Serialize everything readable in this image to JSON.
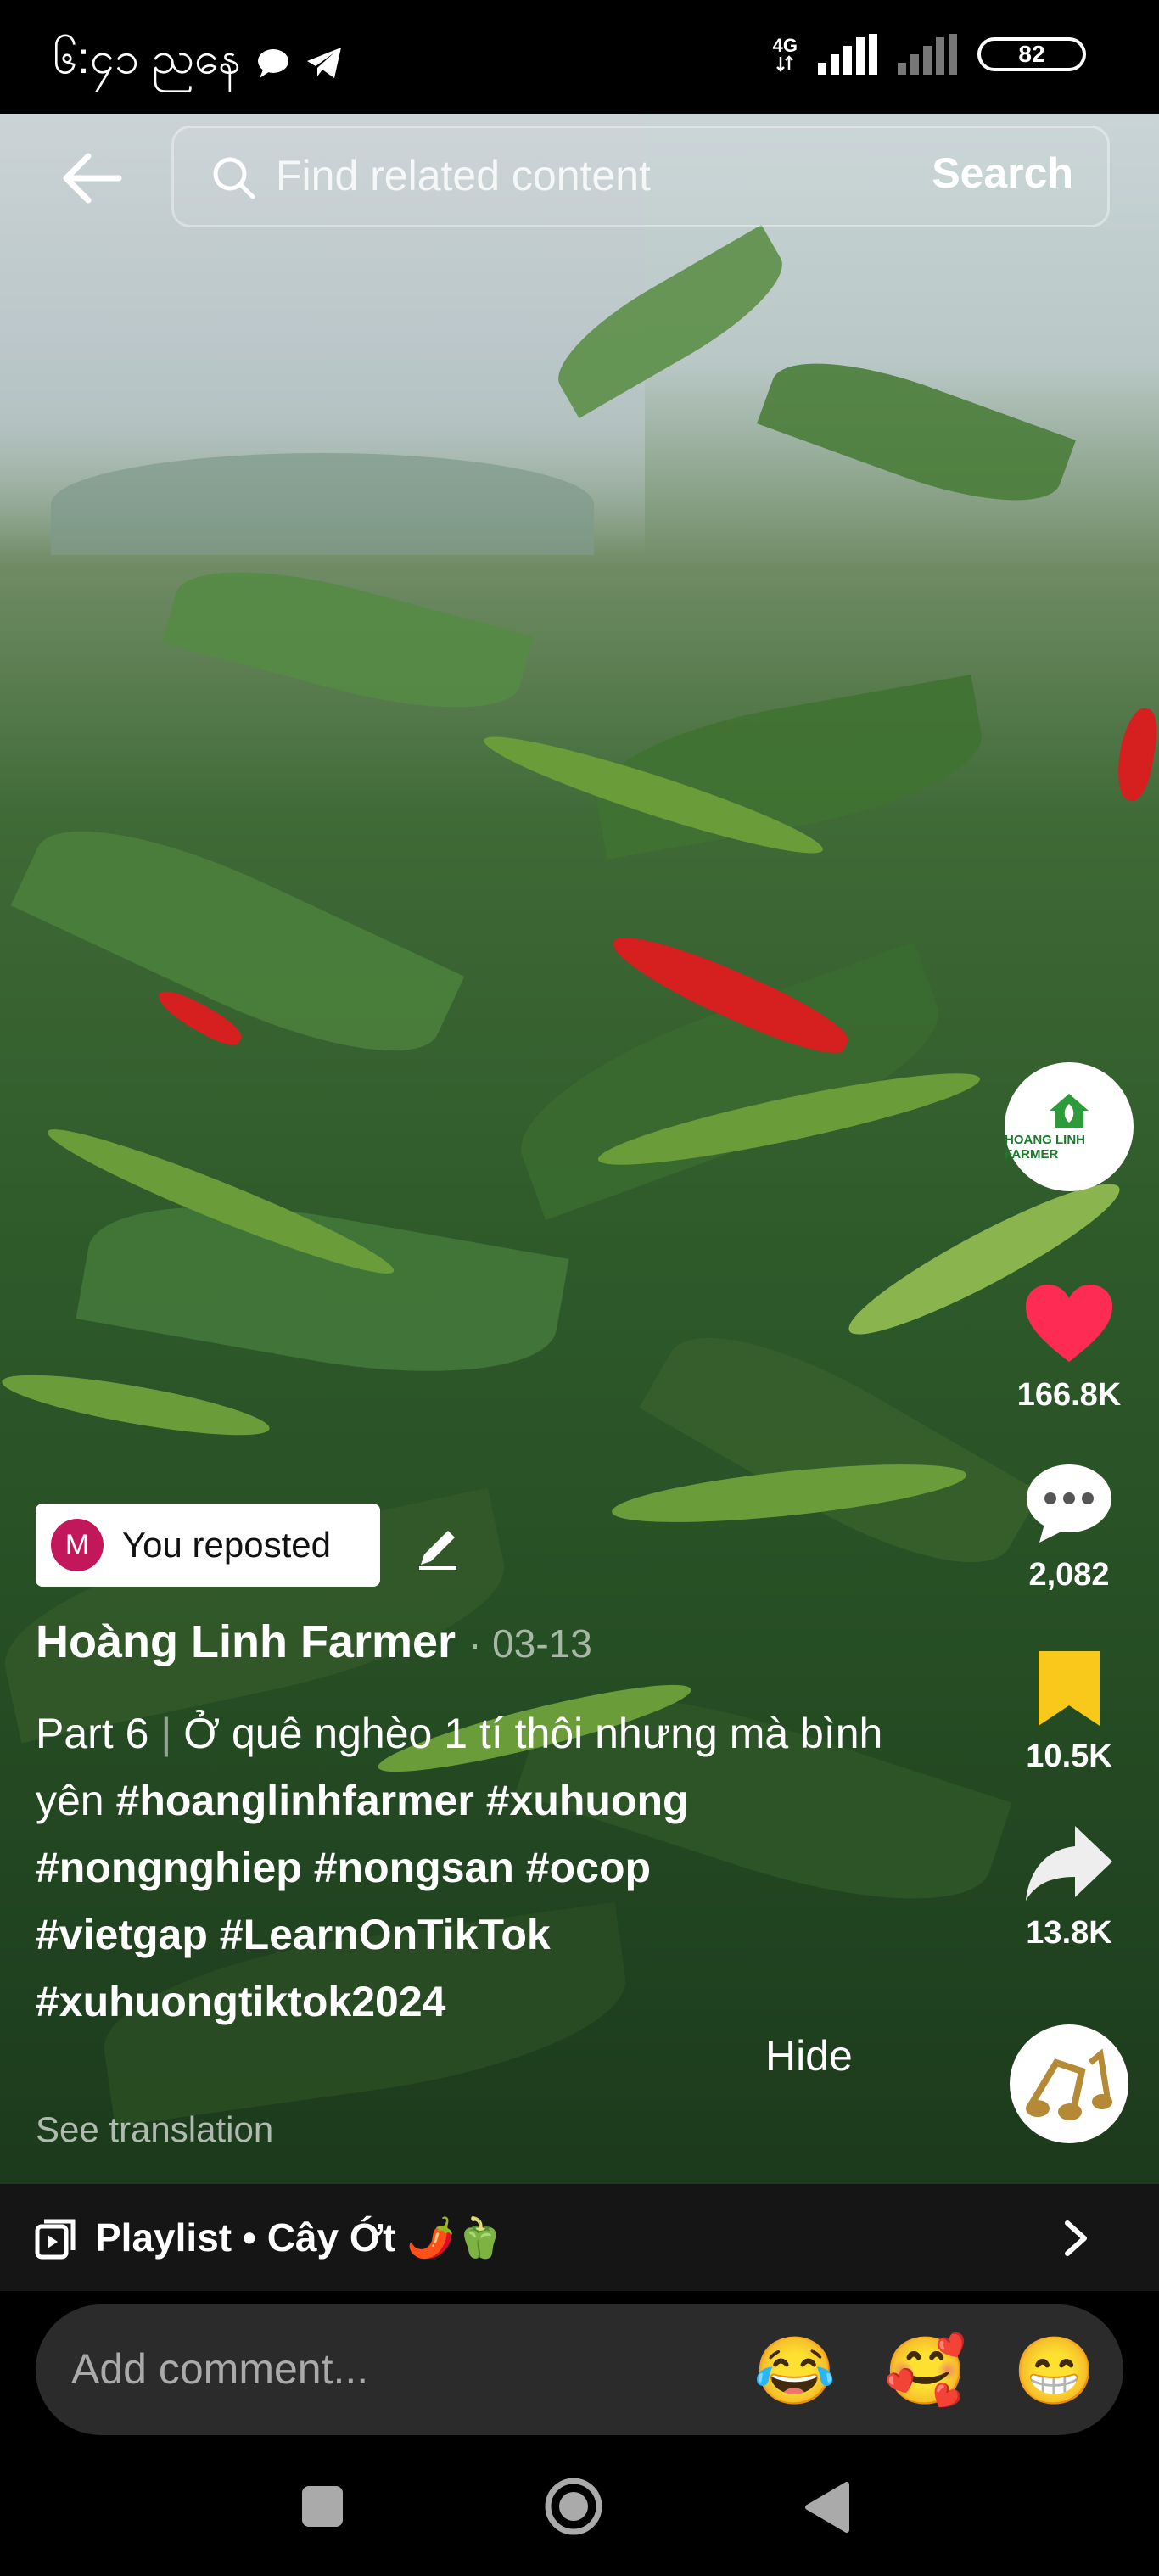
{
  "status_bar": {
    "time": "၆:၄၁ ညနေ",
    "network": "4G",
    "battery": "82"
  },
  "search": {
    "placeholder": "Find related content",
    "button_label": "Search"
  },
  "creator": {
    "avatar_text": "HOANG LINH FARMER"
  },
  "actions": {
    "likes": "166.8K",
    "comments": "2,082",
    "saves": "10.5K",
    "shares": "13.8K"
  },
  "repost": {
    "badge": "M",
    "label": "You reposted"
  },
  "post": {
    "author": "Hoàng Linh Farmer",
    "date": "· 03-13",
    "part": "Part 6",
    "divider": "|",
    "text": " Ở quê nghèo 1 tí thôi nhưng mà bình yên ",
    "hashtags": [
      "#hoanglinhfarmer",
      "#xuhuong",
      "#nongnghiep",
      "#nongsan",
      "#ocop",
      "#vietgap",
      "#LearnOnTikTok",
      "#xuhuongtiktok2024"
    ],
    "hide_label": "Hide",
    "see_translation": "See translation"
  },
  "playlist": {
    "label": "Playlist • Cây Ớt 🌶️🫑"
  },
  "comment": {
    "placeholder": "Add comment...",
    "emojis": [
      "😂",
      "🥰",
      "😁"
    ]
  },
  "colors": {
    "like": "#fe2c55",
    "save": "#f8c91b",
    "badge": "#c2185b"
  }
}
